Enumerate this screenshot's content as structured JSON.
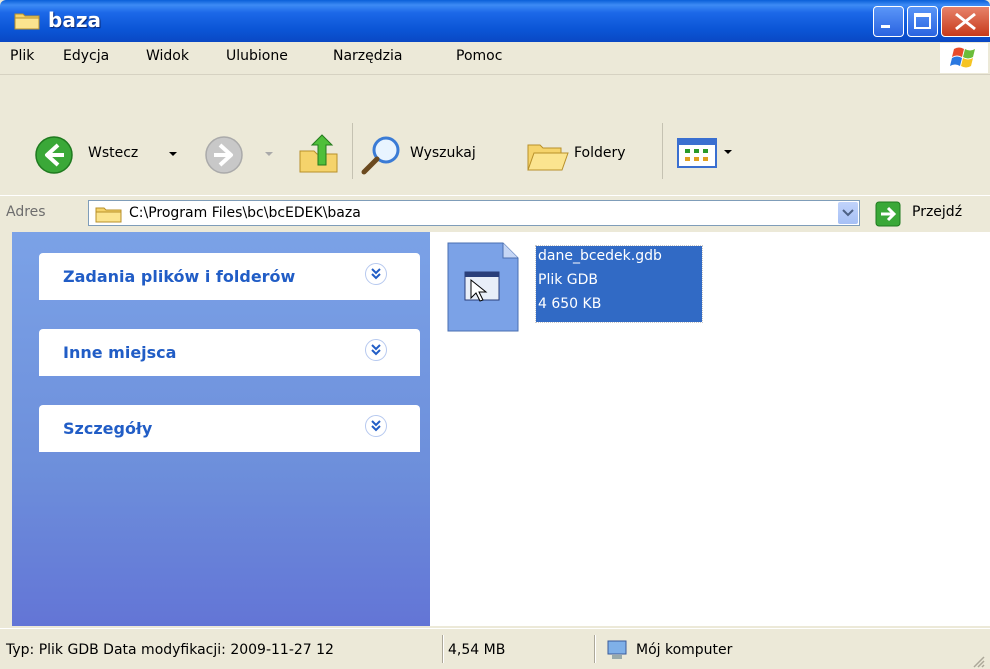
{
  "window": {
    "title": "baza"
  },
  "menu": {
    "items": [
      {
        "label": "Plik"
      },
      {
        "label": "Edycja"
      },
      {
        "label": "Widok"
      },
      {
        "label": "Ulubione"
      },
      {
        "label": "Narzędzia"
      },
      {
        "label": "Pomoc"
      }
    ]
  },
  "toolbar": {
    "back_label": "Wstecz",
    "search_label": "Wyszukaj",
    "folders_label": "Foldery"
  },
  "address": {
    "label": "Adres",
    "path": "C:\\Program Files\\bc\\bcEDEK\\baza",
    "go_label": "Przejdź"
  },
  "taskpane": {
    "panels": [
      {
        "title": "Zadania plików i folderów"
      },
      {
        "title": "Inne miejsca"
      },
      {
        "title": "Szczegóły"
      }
    ]
  },
  "files": [
    {
      "name": "dane_bcedek.gdb",
      "type": "Plik GDB",
      "size": "4 650 KB",
      "selected": true
    }
  ],
  "statusbar": {
    "info": "Typ: Plik GDB Data modyfikacji: 2009-11-27 12",
    "size": "4,54 MB",
    "location": "Mój komputer"
  }
}
